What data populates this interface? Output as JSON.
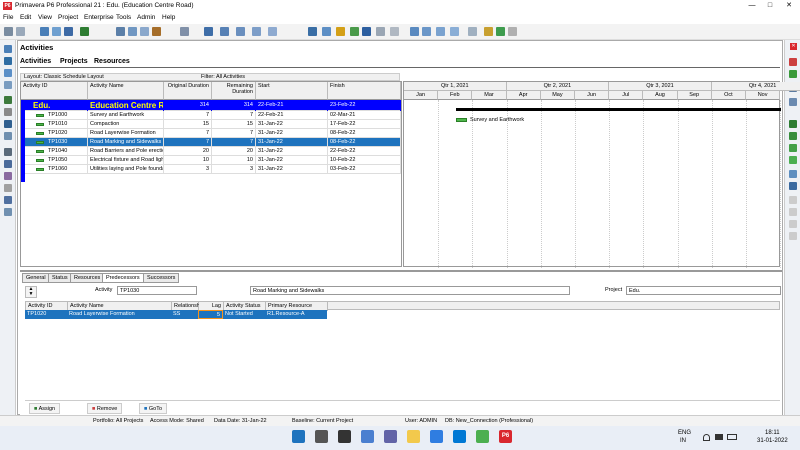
{
  "window": {
    "title": "Primavera P6 Professional 21 : Edu. (Education Centre Road)",
    "app_icon": "P6"
  },
  "menu": [
    "File",
    "Edit",
    "View",
    "Project",
    "Enterprise",
    "Tools",
    "Admin",
    "Help"
  ],
  "panel": {
    "title": "Activities",
    "tabs": [
      "Activities",
      "Projects",
      "Resources"
    ],
    "layout": "Layout: Classic Schedule Layout",
    "filter": "Filter: All Activities"
  },
  "columns": {
    "id": "Activity ID",
    "name": "Activity Name",
    "orig": "Original Duration",
    "rem": "Remaining Duration",
    "start": "Start",
    "finish": "Finish"
  },
  "wbs": {
    "id": "Edu.",
    "name": "Education Centre Road",
    "orig": "314",
    "rem": "314",
    "start": "22-Feb-21",
    "finish": "23-Feb-22"
  },
  "activities": [
    {
      "id": "TP1000",
      "name": "Survey and Earthwork",
      "orig": "7",
      "rem": "7",
      "start": "22-Feb-21",
      "finish": "02-Mar-21"
    },
    {
      "id": "TP1010",
      "name": "Compaction",
      "orig": "15",
      "rem": "15",
      "start": "31-Jan-22",
      "finish": "17-Feb-22"
    },
    {
      "id": "TP1020",
      "name": "Road Layerwise Formation",
      "orig": "7",
      "rem": "7",
      "start": "31-Jan-22",
      "finish": "08-Feb-22"
    },
    {
      "id": "TP1030",
      "name": "Road Marking and Sidewalks",
      "orig": "7",
      "rem": "7",
      "start": "31-Jan-22",
      "finish": "08-Feb-22"
    },
    {
      "id": "TP1040",
      "name": "Road Barriers and Pole erection",
      "orig": "20",
      "rem": "20",
      "start": "31-Jan-22",
      "finish": "22-Feb-22"
    },
    {
      "id": "TP1050",
      "name": "Electrical fixture and Road lights",
      "orig": "10",
      "rem": "10",
      "start": "31-Jan-22",
      "finish": "10-Feb-22"
    },
    {
      "id": "TP1060",
      "name": "Utilities laying and Pole foundation",
      "orig": "3",
      "rem": "3",
      "start": "31-Jan-22",
      "finish": "03-Feb-22"
    }
  ],
  "gantt": {
    "quarters": [
      "Qtr 1, 2021",
      "Qtr 2, 2021",
      "Qtr 3, 2021",
      "Qtr 4, 2021"
    ],
    "months": [
      "Jan",
      "Feb",
      "Mar",
      "Apr",
      "May",
      "Jun",
      "Jul",
      "Aug",
      "Sep",
      "Oct",
      "Nov"
    ],
    "bar_label": "Survey and Earthwork"
  },
  "details": {
    "tabs": [
      "General",
      "Status",
      "Resources",
      "Predecessors",
      "Successors"
    ],
    "activity_label": "Activity",
    "activity_id": "TP1030",
    "activity_name": "Road Marking and Sidewalks",
    "project_label": "Project",
    "project_value": "Edu.",
    "pred_columns": [
      "Activity ID",
      "Activity Name",
      "Relationship",
      "Lag",
      "Activity Status",
      "Primary Resource"
    ],
    "pred_row": {
      "id": "TP1020",
      "name": "Road Layerwise Formation",
      "rel": "SS",
      "lag": "5",
      "status": "Not Started",
      "resource": "R1.Resource-A"
    },
    "buttons": [
      "Assign",
      "Remove",
      "GoTo"
    ]
  },
  "status": {
    "portfolio": "Portfolio: All Projects",
    "access": "Access Mode: Shared",
    "datadate": "Data Date: 31-Jan-22",
    "baseline": "Baseline: Current Project",
    "user": "User: ADMIN",
    "db": "DB: New_Connection (Professional)"
  },
  "taskbar": {
    "lang1": "ENG",
    "lang2": "IN",
    "time": "18:11",
    "date": "31-01-2022"
  }
}
